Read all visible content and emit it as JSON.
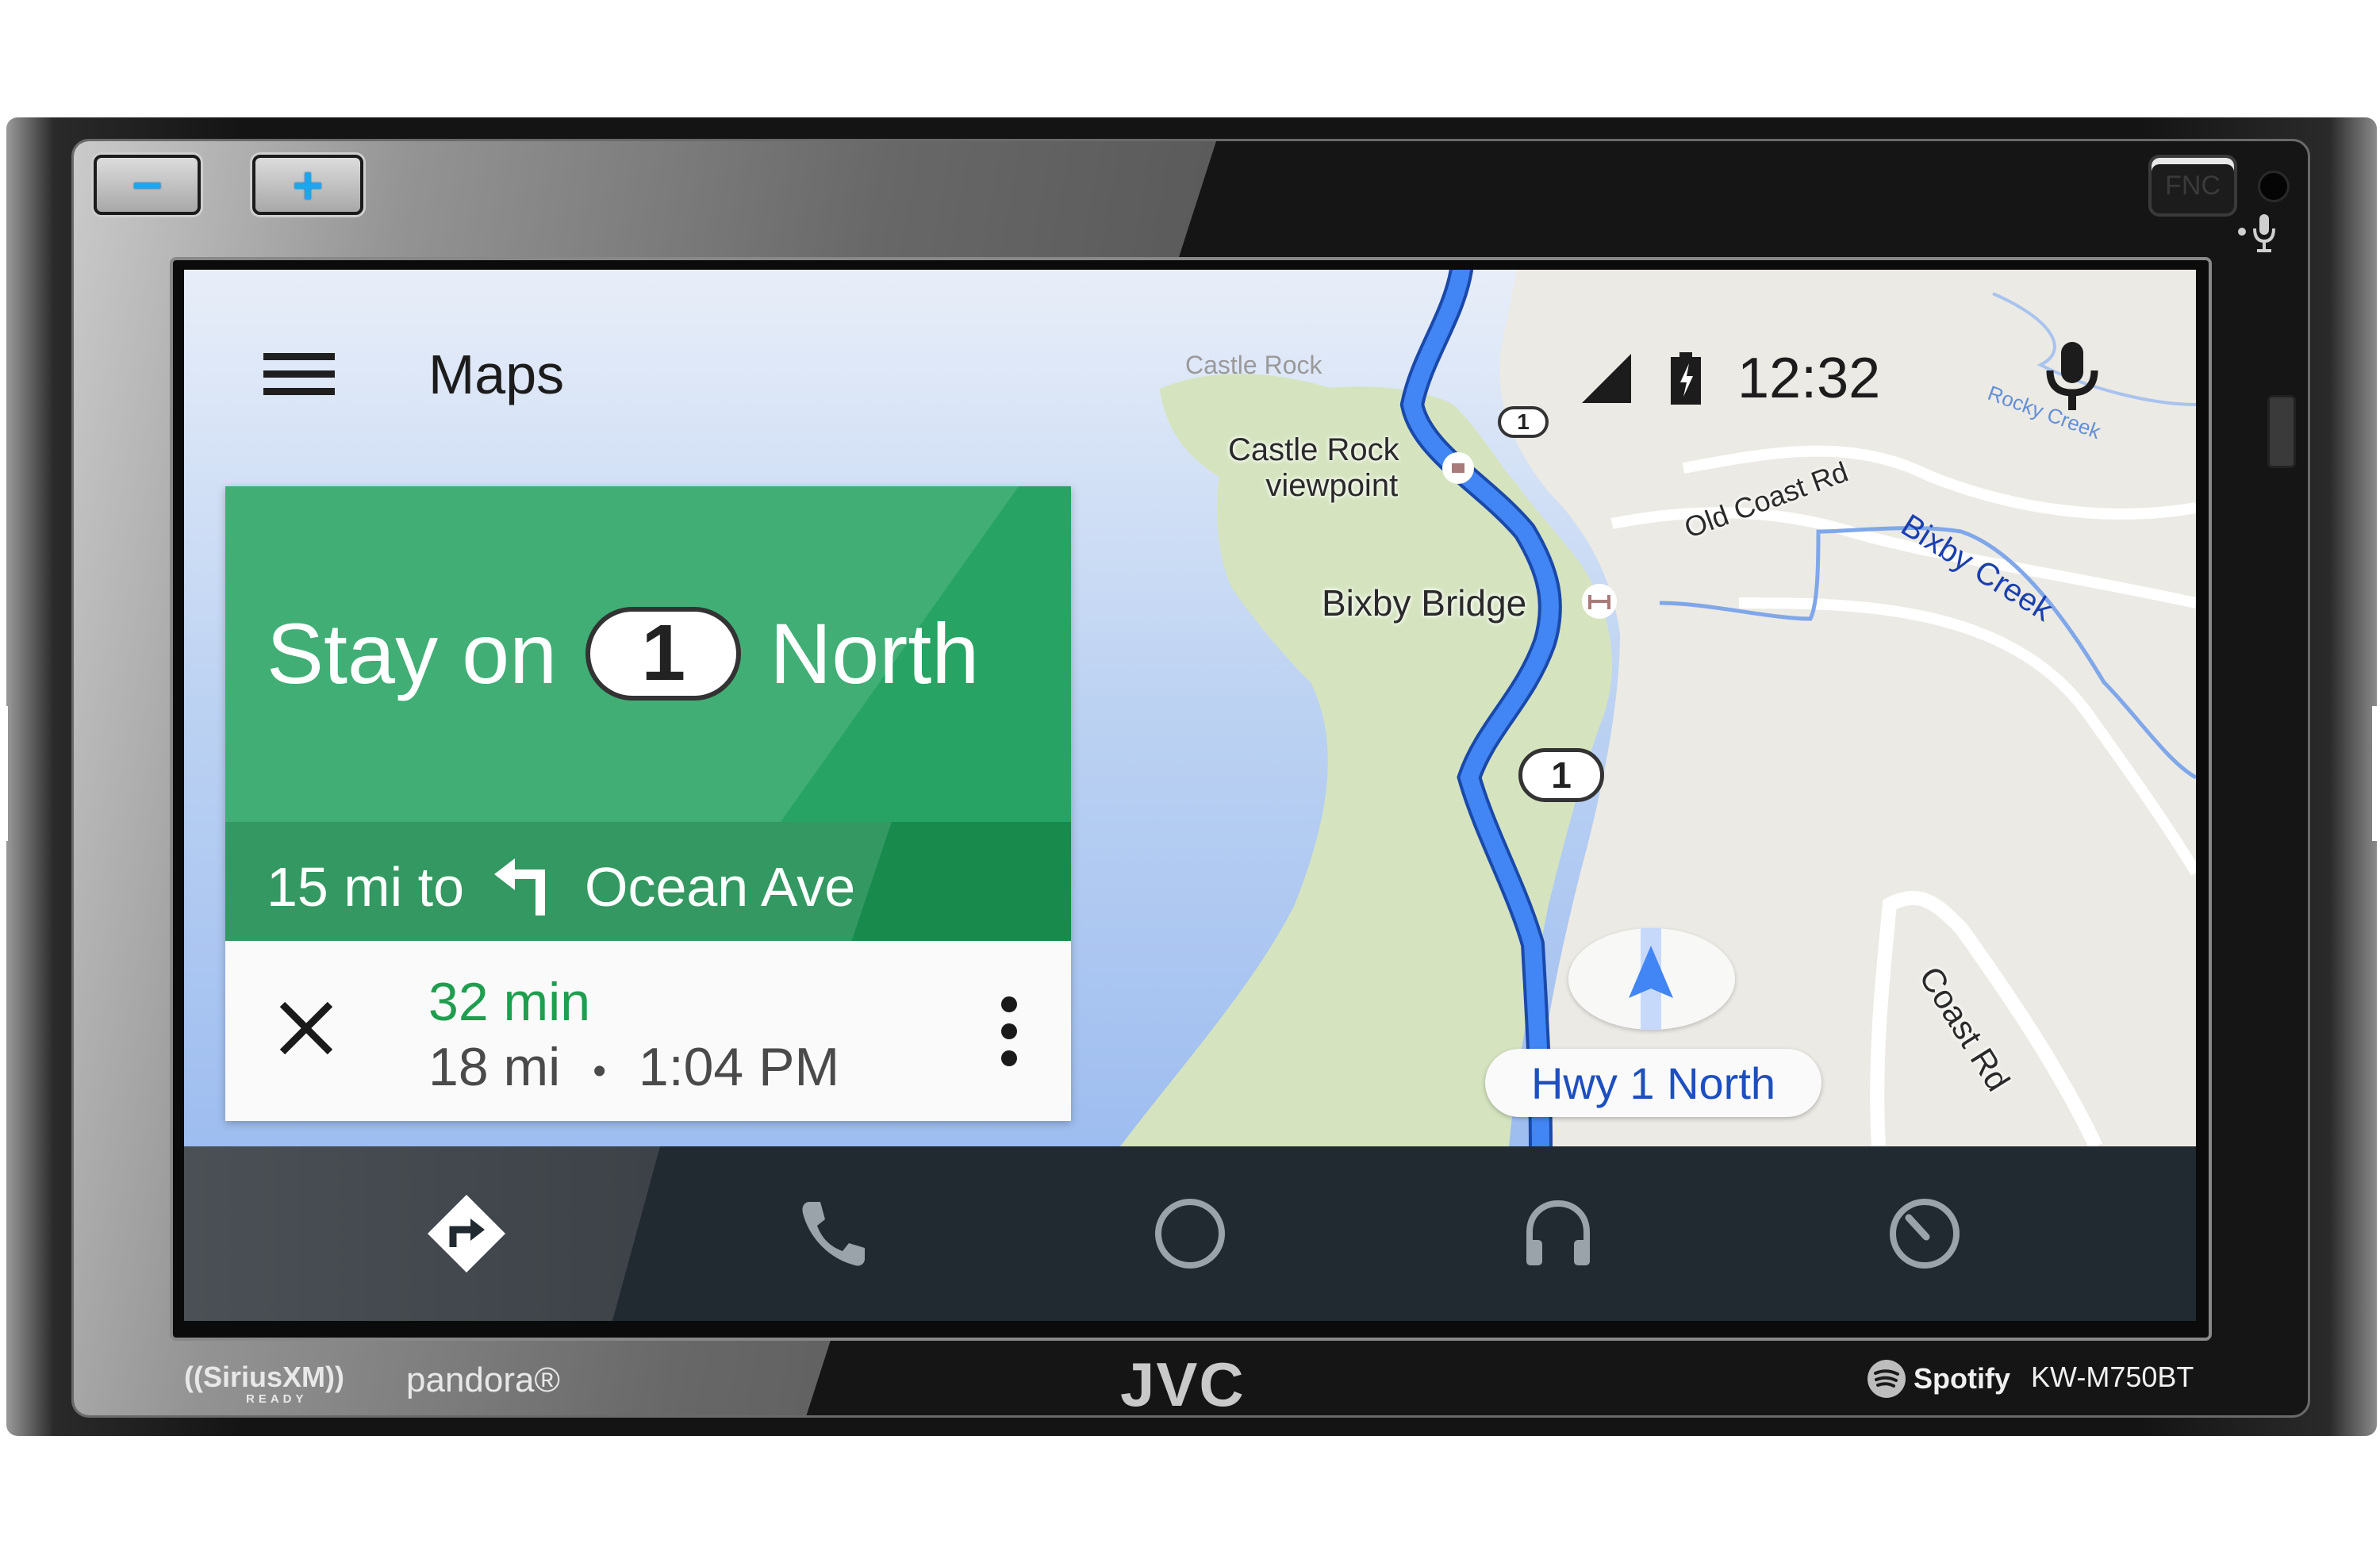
{
  "device": {
    "brand": "JVC",
    "model": "KW-M750BT",
    "hardware_buttons": {
      "volume_down_glyph": "−",
      "volume_up_glyph": "+",
      "fnc_label": "FNC"
    },
    "badges": {
      "siriusxm": "((SiriusXM))",
      "siriusxm_sub": "READY",
      "pandora": "pandora®",
      "spotify": "Spotify"
    }
  },
  "app": {
    "title": "Maps",
    "menu_icon": "hamburger-menu-icon",
    "voice_icon": "microphone-icon"
  },
  "status_bar": {
    "signal_icon": "cell-signal-icon",
    "battery_icon": "battery-charging-icon",
    "time": "12:32"
  },
  "navigation": {
    "instruction_prefix": "Stay on",
    "route_number": "1",
    "instruction_suffix": "North",
    "next_distance": "15 mi to",
    "next_turn_icon": "turn-left-icon",
    "next_street": "Ocean Ave",
    "eta_duration": "32 min",
    "eta_distance": "18 mi",
    "eta_separator": "•",
    "eta_arrival": "1:04 PM",
    "close_icon": "close-icon",
    "more_icon": "more-vert-icon",
    "current_road": "Hwy 1 North",
    "colors": {
      "card_green": "#27a363",
      "card_green_dark": "#178a4c",
      "eta_green": "#1f9e4f",
      "route_blue": "#4285f4"
    }
  },
  "map": {
    "labels": {
      "castle_rock": "Castle Rock",
      "castle_rock_viewpoint_1": "Castle Rock",
      "castle_rock_viewpoint_2": "viewpoint",
      "bixby_bridge": "Bixby Bridge",
      "old_coast_rd": "Old Coast Rd",
      "bixby_creek": "Bixby Creek",
      "rocky_creek": "Rocky Creek",
      "coast_rd": "Coast Rd"
    },
    "route_shields": [
      "1",
      "1"
    ]
  },
  "dock": {
    "items": [
      {
        "name": "navigation",
        "icon": "navigation-directions-icon",
        "active": true
      },
      {
        "name": "phone",
        "icon": "phone-icon",
        "active": false
      },
      {
        "name": "home",
        "icon": "home-circle-icon",
        "active": false
      },
      {
        "name": "media",
        "icon": "headphones-icon",
        "active": false
      },
      {
        "name": "exit",
        "icon": "exit-dial-icon",
        "active": false
      }
    ]
  }
}
